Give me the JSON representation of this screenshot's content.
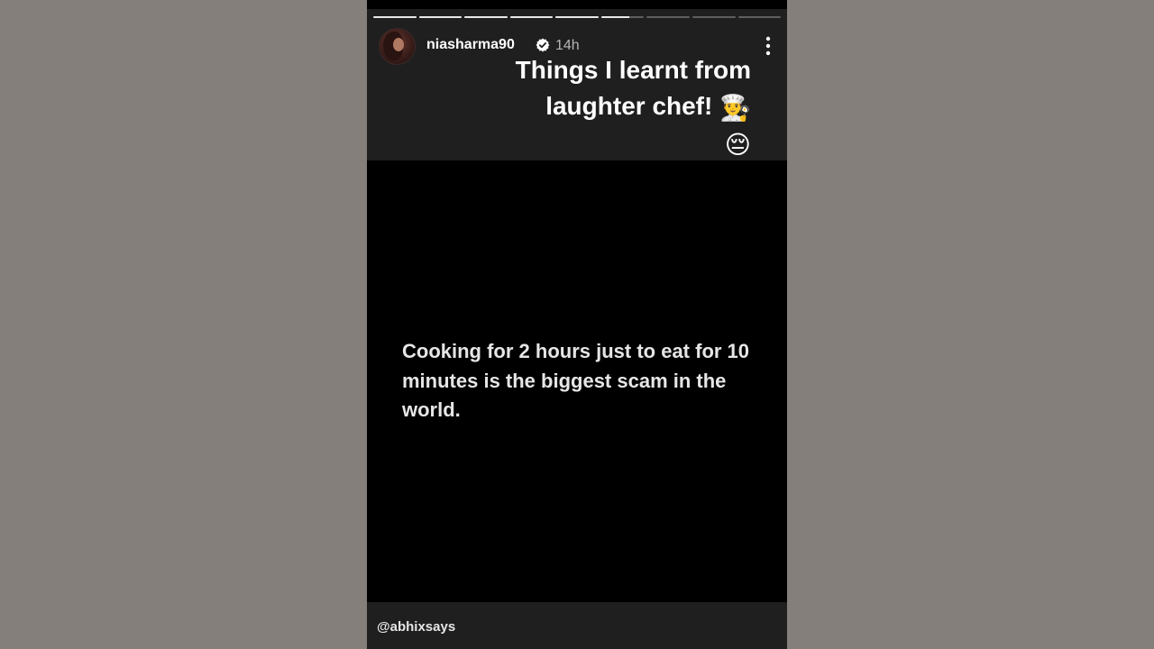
{
  "story": {
    "progress": {
      "segments": 9,
      "completed_segments": 5,
      "current_segment_fraction": 0.65
    },
    "header": {
      "username": "niasharma90",
      "time": "14h",
      "avatar": "profile-photo",
      "verified_icon": "verified-badge-icon",
      "more_icon": "vertical-ellipsis-icon"
    },
    "title": {
      "line1": "Things I learnt from",
      "line2": "laughter chef!",
      "emoji1": "👨‍🍳",
      "emoji2": "😔"
    },
    "main_text": "Cooking for 2 hours just to eat for 10 minutes is the biggest scam in the world.",
    "credit": "@abhixsays"
  },
  "colors": {
    "page_background": "#847f7b",
    "story_background": "#000000",
    "bar_background": "#1f1f1f",
    "text_primary": "#ffffff",
    "text_secondary": "#b5b5b5"
  }
}
